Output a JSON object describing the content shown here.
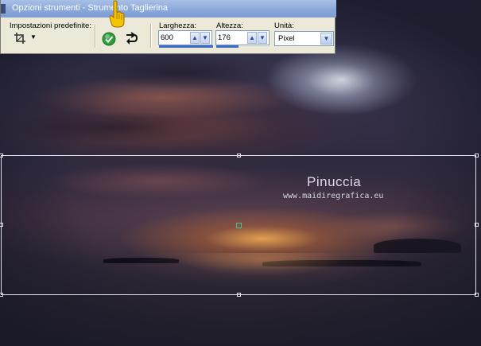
{
  "palette": {
    "title": "Opzioni strumenti - Strumento Taglierina",
    "presets_label": "Impostazioni predefinite:",
    "width_label": "Larghezza:",
    "width_value": "600",
    "height_label": "Altezza:",
    "height_value": "176",
    "units_label": "Unità:",
    "units_value": "Pixel",
    "icons": {
      "preset": "crop-icon",
      "apply": "checkmark-icon",
      "reset": "reset-arrow-icon"
    }
  },
  "watermark": {
    "name": "Pinuccia",
    "url": "www.maidiregrafica.eu"
  },
  "colors": {
    "titlebar": "#8aa8da",
    "palette_bg": "#ece9d8",
    "apply_green": "#2e9e3a",
    "crop_center": "#40c0a0",
    "pointer_yellow": "#f5c400"
  }
}
